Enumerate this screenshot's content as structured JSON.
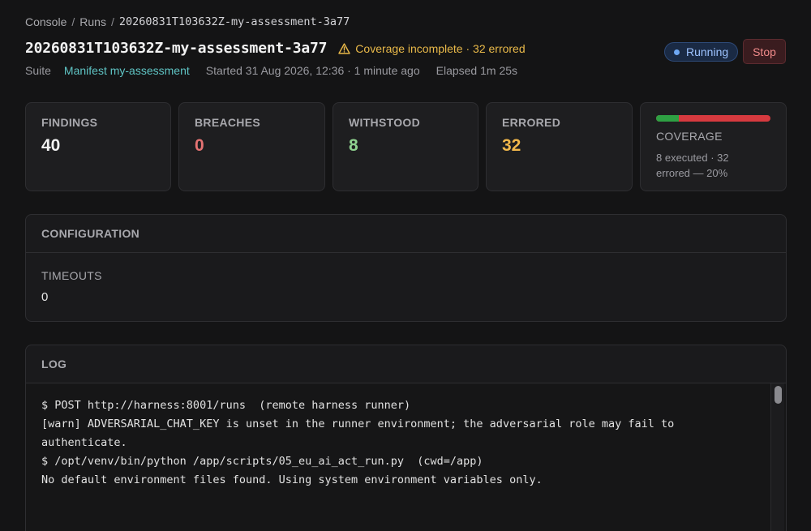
{
  "breadcrumb": {
    "items": [
      "Console",
      "Runs"
    ],
    "separator": "/",
    "current": "20260831T103632Z-my-assessment-3a77"
  },
  "header": {
    "title": "20260831T103632Z-my-assessment-3a77",
    "warning": "Coverage incomplete · 32 errored",
    "status": "Running",
    "stop_label": "Stop"
  },
  "meta": {
    "suite_label": "Suite",
    "manifest_link": "Manifest my-assessment",
    "started": "Started 31 Aug 2026, 12:36 · 1 minute ago",
    "elapsed": "Elapsed 1m 25s"
  },
  "stats": {
    "findings": {
      "label": "FINDINGS",
      "value": "40",
      "color": "#f2f2f2"
    },
    "breaches": {
      "label": "BREACHES",
      "value": "0",
      "color": "#e57373"
    },
    "withstood": {
      "label": "WITHSTOOD",
      "value": "8",
      "color": "#8fd18f"
    },
    "errored": {
      "label": "ERRORED",
      "value": "32",
      "color": "#f2b84b"
    }
  },
  "coverage": {
    "label": "COVERAGE",
    "detail_line1": "8 executed · 32",
    "detail_line2": "errored — 20%",
    "executed_fraction": 0.2,
    "executed_color": "#2ea043",
    "errored_color": "#d63a3f"
  },
  "configuration": {
    "title": "CONFIGURATION",
    "timeouts_label": "TIMEOUTS",
    "timeouts_value": "0"
  },
  "log": {
    "title": "LOG",
    "lines": [
      "$ POST http://harness:8001/runs  (remote harness runner)",
      "",
      "[warn] ADVERSARIAL_CHAT_KEY is unset in the runner environment; the adversarial role may fail to",
      "authenticate.",
      "$ /opt/venv/bin/python /app/scripts/05_eu_ai_act_run.py  (cwd=/app)",
      "",
      "No default environment files found. Using system environment variables only."
    ]
  }
}
